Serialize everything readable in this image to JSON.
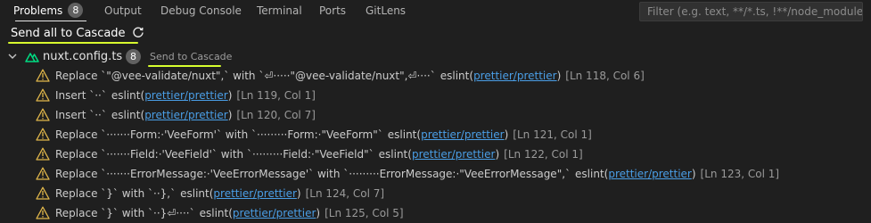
{
  "tabs": [
    {
      "label": "Problems",
      "badge": "8",
      "active": true
    },
    {
      "label": "Output"
    },
    {
      "label": "Debug Console"
    },
    {
      "label": "Terminal"
    },
    {
      "label": "Ports"
    },
    {
      "label": "GitLens"
    }
  ],
  "filter": {
    "placeholder": "Filter (e.g. text, **/*.ts, !**/node_modules/**)"
  },
  "send_all": {
    "label": "Send all to Cascade",
    "icon": "refresh-icon"
  },
  "file": {
    "name": "nuxt.config.ts",
    "count": "8",
    "send_label": "Send to Cascade",
    "icon": "nuxt-icon"
  },
  "problems": [
    {
      "message": "Replace `\"@vee-validate/nuxt\",` with `⏎·····\"@vee-validate/nuxt\",⏎····`",
      "source": "eslint",
      "rule": "prettier/prettier",
      "location": "[Ln 118, Col 6]"
    },
    {
      "message": "Insert `··`",
      "source": "eslint",
      "rule": "prettier/prettier",
      "location": "[Ln 119, Col 1]"
    },
    {
      "message": "Insert `··`",
      "source": "eslint",
      "rule": "prettier/prettier",
      "location": "[Ln 120, Col 7]"
    },
    {
      "message": "Replace `·······Form:·'VeeForm'` with `·········Form:·\"VeeForm\"`",
      "source": "eslint",
      "rule": "prettier/prettier",
      "location": "[Ln 121, Col 1]"
    },
    {
      "message": "Replace `·······Field:·'VeeField'` with `·········Field:·\"VeeField\"`",
      "source": "eslint",
      "rule": "prettier/prettier",
      "location": "[Ln 122, Col 1]"
    },
    {
      "message": "Replace `·······ErrorMessage:·'VeeErrorMessage'` with `·········ErrorMessage:·\"VeeErrorMessage\",`",
      "source": "eslint",
      "rule": "prettier/prettier",
      "location": "[Ln 123, Col 1]"
    },
    {
      "message": "Replace `}` with `··},`",
      "source": "eslint",
      "rule": "prettier/prettier",
      "location": "[Ln 124, Col 7]"
    },
    {
      "message": "Replace `}` with `··}⏎····`",
      "source": "eslint",
      "rule": "prettier/prettier",
      "location": "[Ln 125, Col 5]"
    }
  ],
  "colors": {
    "accent_highlight": "#d8ff2e",
    "warning": "#e0b64a",
    "link": "#4a9ee6",
    "nuxt": "#00dc82"
  }
}
